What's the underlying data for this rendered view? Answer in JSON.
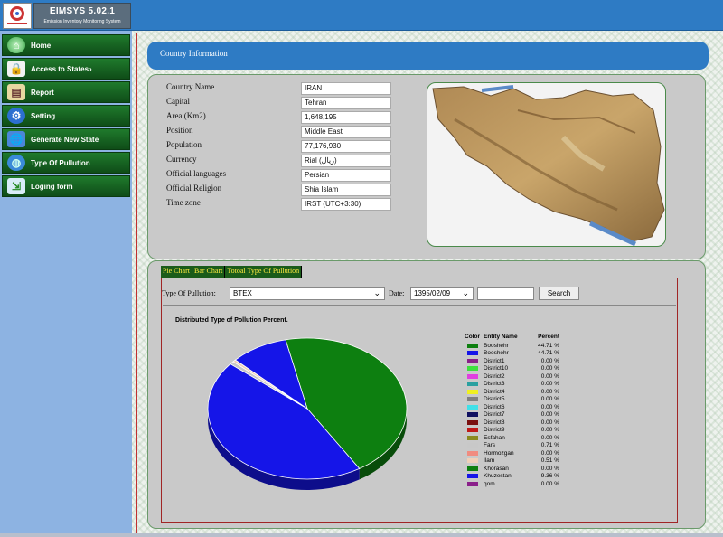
{
  "header": {
    "title": "EIMSYS 5.02.1",
    "subtitle": "Emission Inventory Monitoring System"
  },
  "sidebar": {
    "items": [
      {
        "label": "Home",
        "icon": "home-icon"
      },
      {
        "label": "Access to States",
        "icon": "lock-icon"
      },
      {
        "label": "Report",
        "icon": "report-icon"
      },
      {
        "label": "Setting",
        "icon": "gear-icon"
      },
      {
        "label": "Generate New State",
        "icon": "globe-icon"
      },
      {
        "label": "Type Of Pullution",
        "icon": "earth-icon"
      },
      {
        "label": "Loging form",
        "icon": "login-icon"
      }
    ]
  },
  "country": {
    "heading": "Country Information",
    "fields": [
      {
        "label": "Country Name",
        "value": "IRAN"
      },
      {
        "label": "Capital",
        "value": "Tehran"
      },
      {
        "label": "Area (Km2)",
        "value": "1,648,195"
      },
      {
        "label": "Position",
        "value": "Middle East"
      },
      {
        "label": "Population",
        "value": "77,176,930"
      },
      {
        "label": "Currency",
        "value": "Rial (ریال)"
      },
      {
        "label": "Official languages",
        "value": "Persian"
      },
      {
        "label": "Official Religion",
        "value": "Shia Islam"
      },
      {
        "label": "Time zone",
        "value": "IRST (UTC+3:30)"
      }
    ]
  },
  "tabs": [
    "Pie Chart",
    "Bar Chart",
    "Totoal Type Of Pullution"
  ],
  "filters": {
    "type_label": "Type Of Pullution:",
    "type_value": "BTEX",
    "date_label": "Date:",
    "date_value": "1395/02/09",
    "search_value": "",
    "search_button": "Search"
  },
  "chart_data": {
    "type": "pie",
    "title": "Distributed Type of Pollution Percent.",
    "legend_headers": [
      "Color",
      "Entity Name",
      "Percent"
    ],
    "slices": [
      {
        "name": "Booshehr",
        "percent": 44.71,
        "display": "44.71 %",
        "color": "#0d7f10"
      },
      {
        "name": "Booshehr",
        "percent": 44.71,
        "display": "44.71 %",
        "color": "#1515e8"
      },
      {
        "name": "District1",
        "percent": 0.0,
        "display": "0.00 %",
        "color": "#8a1f8a"
      },
      {
        "name": "District10",
        "percent": 0.0,
        "display": "0.00 %",
        "color": "#3ee03e"
      },
      {
        "name": "District2",
        "percent": 0.0,
        "display": "0.00 %",
        "color": "#e040e0"
      },
      {
        "name": "District3",
        "percent": 0.0,
        "display": "0.00 %",
        "color": "#2aa0a0"
      },
      {
        "name": "District4",
        "percent": 0.0,
        "display": "0.00 %",
        "color": "#f0f020"
      },
      {
        "name": "District5",
        "percent": 0.0,
        "display": "0.00 %",
        "color": "#808080"
      },
      {
        "name": "District6",
        "percent": 0.0,
        "display": "0.00 %",
        "color": "#40e0e8"
      },
      {
        "name": "District7",
        "percent": 0.0,
        "display": "0.00 %",
        "color": "#101060"
      },
      {
        "name": "District8",
        "percent": 0.0,
        "display": "0.00 %",
        "color": "#7a1010"
      },
      {
        "name": "District9",
        "percent": 0.0,
        "display": "0.00 %",
        "color": "#c01818"
      },
      {
        "name": "Esfahan",
        "percent": 0.0,
        "display": "0.00 %",
        "color": "#8a8a20"
      },
      {
        "name": "Fars",
        "percent": 0.71,
        "display": "0.71 %",
        "color": "#c8c8c8"
      },
      {
        "name": "Hormozgan",
        "percent": 0.0,
        "display": "0.00 %",
        "color": "#f08c80"
      },
      {
        "name": "Ilam",
        "percent": 0.51,
        "display": "0.51 %",
        "color": "#f0d0b8"
      },
      {
        "name": "Khorasan",
        "percent": 0.0,
        "display": "0.00 %",
        "color": "#0d7f10"
      },
      {
        "name": "Khuzestan",
        "percent": 9.36,
        "display": "9.36 %",
        "color": "#1515e8"
      },
      {
        "name": "qom",
        "percent": 0.0,
        "display": "0.00 %",
        "color": "#8a1f8a"
      }
    ]
  }
}
